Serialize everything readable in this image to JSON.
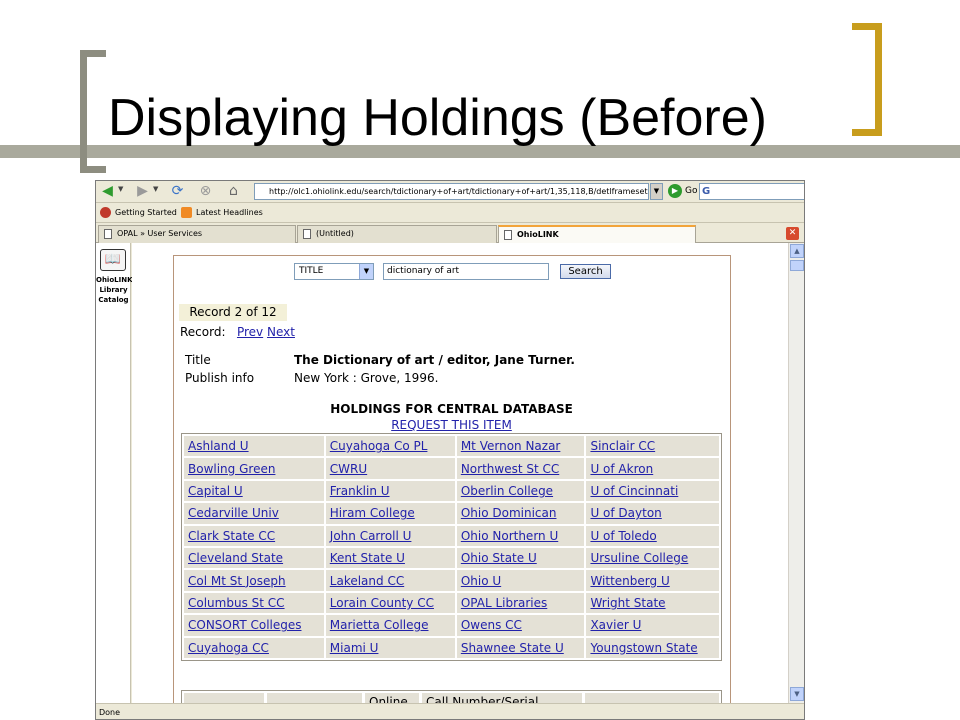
{
  "slide": {
    "title": "Displaying Holdings (Before)"
  },
  "browser": {
    "address_url": "http://olc1.ohiolink.edu/search/tdictionary+of+art/tdictionary+of+art/1,35,118,B/detlframeset",
    "go_label": "Go",
    "search_value": "G",
    "bookmarks": [
      {
        "label": "Getting Started",
        "icon": "firefox-icon"
      },
      {
        "label": "Latest Headlines",
        "icon": "rss-icon"
      }
    ],
    "tabs": [
      {
        "label": "OPAL » User Services"
      },
      {
        "label": "(Untitled)"
      },
      {
        "label": "OhioLINK"
      }
    ],
    "sidebar_label": "OhioLINK Library Catalog",
    "status": "Done"
  },
  "catalog": {
    "search_type": "TITLE",
    "search_query": "dictionary of art",
    "search_button": "Search",
    "record_position": "Record 2 of 12",
    "record_label": "Record:",
    "prev_label": "Prev",
    "next_label": "Next",
    "title_label": "Title",
    "title_value": "The Dictionary of art / editor, Jane Turner.",
    "publish_label": "Publish info",
    "publish_value": "New York : Grove, 1996.",
    "holdings_title": "HOLDINGS FOR CENTRAL DATABASE",
    "request_link": "REQUEST THIS ITEM",
    "holdings_rows": [
      [
        "Ashland U",
        "Cuyahoga Co PL",
        "Mt Vernon Nazar",
        "Sinclair CC"
      ],
      [
        "Bowling Green",
        "CWRU",
        "Northwest St CC",
        "U of Akron"
      ],
      [
        "Capital U",
        "Franklin U",
        "Oberlin College",
        "U of Cincinnati"
      ],
      [
        "Cedarville Univ",
        "Hiram College",
        "Ohio Dominican",
        "U of Dayton"
      ],
      [
        "Clark State CC",
        "John Carroll U",
        "Ohio Northern U",
        "U of Toledo"
      ],
      [
        "Cleveland State",
        "Kent State U",
        "Ohio State U",
        "Ursuline College"
      ],
      [
        "Col Mt St Joseph",
        "Lakeland CC",
        "Ohio U",
        "Wittenberg U"
      ],
      [
        "Columbus St CC",
        "Lorain County CC",
        "OPAL Libraries",
        "Wright State"
      ],
      [
        "CONSORT Colleges",
        "Marietta College",
        "Owens CC",
        "Xavier U"
      ],
      [
        "Cuyahoga CC",
        "Miami U",
        "Shawnee State U",
        "Youngstown State"
      ]
    ],
    "lower_headers": [
      "Online",
      "Call Number/Serial"
    ]
  }
}
